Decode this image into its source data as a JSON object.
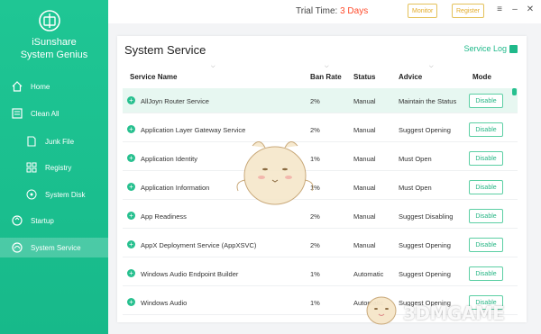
{
  "app": {
    "name_line1": "iSunshare",
    "name_line2": "System Genius"
  },
  "topbar": {
    "trial_label": "Trial Time:",
    "trial_days": "3 Days",
    "btn_a": "Monitor",
    "btn_b": "Register"
  },
  "sidebar": {
    "items": [
      {
        "label": "Home",
        "icon": "home-icon"
      },
      {
        "label": "Clean All",
        "icon": "clean-icon"
      },
      {
        "label": "Junk File",
        "icon": "junk-file-icon"
      },
      {
        "label": "Registry",
        "icon": "registry-icon"
      },
      {
        "label": "System Disk",
        "icon": "system-disk-icon"
      },
      {
        "label": "Startup",
        "icon": "startup-icon"
      },
      {
        "label": "System Service",
        "icon": "system-service-icon",
        "active": true
      }
    ]
  },
  "main": {
    "title": "System Service",
    "log_link": "Service Log",
    "columns": {
      "name": "Service Name",
      "ban_rate": "Ban Rate",
      "status": "Status",
      "advice": "Advice",
      "mode": "Mode"
    },
    "rows": [
      {
        "name": "AllJoyn Router Service",
        "ban_rate": "2%",
        "status": "Manual",
        "advice": "Maintain the Status",
        "mode": "Disable"
      },
      {
        "name": "Application Layer Gateway Service",
        "ban_rate": "2%",
        "status": "Manual",
        "advice": "Suggest Opening",
        "mode": "Disable"
      },
      {
        "name": "Application Identity",
        "ban_rate": "1%",
        "status": "Manual",
        "advice": "Must Open",
        "mode": "Disable"
      },
      {
        "name": "Application Information",
        "ban_rate": "1%",
        "status": "Manual",
        "advice": "Must Open",
        "mode": "Disable"
      },
      {
        "name": "App Readiness",
        "ban_rate": "2%",
        "status": "Manual",
        "advice": "Suggest Disabling",
        "mode": "Disable"
      },
      {
        "name": "AppX Deployment Service (AppXSVC)",
        "ban_rate": "2%",
        "status": "Manual",
        "advice": "Suggest Opening",
        "mode": "Disable"
      },
      {
        "name": "Windows Audio Endpoint Builder",
        "ban_rate": "1%",
        "status": "Automatic",
        "advice": "Suggest Opening",
        "mode": "Disable"
      },
      {
        "name": "Windows Audio",
        "ban_rate": "1%",
        "status": "Automatic",
        "advice": "Suggest Opening",
        "mode": "Disable"
      }
    ]
  },
  "watermark": "3DMGAME",
  "colors": {
    "accent": "#1fc694",
    "trial_days": "#ff4b2b",
    "top_button": "#e3ac2c",
    "selected_row": "#e7f7f1"
  }
}
